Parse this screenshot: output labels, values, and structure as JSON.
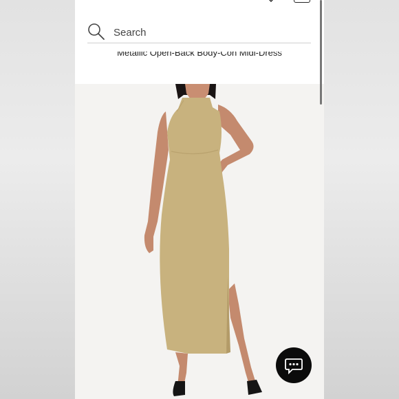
{
  "search": {
    "placeholder": "Search"
  },
  "product": {
    "title": "Metallic Open-Back Body-Con Midi-Dress"
  },
  "icons": {
    "heart": "heart-icon",
    "bag": "shopping-bag-icon",
    "search": "search-icon",
    "chat": "chat-bubble-icon"
  },
  "colors": {
    "dress": "#c8b27e",
    "chat_button": "#0b0b0b",
    "background": "#ffffff"
  }
}
